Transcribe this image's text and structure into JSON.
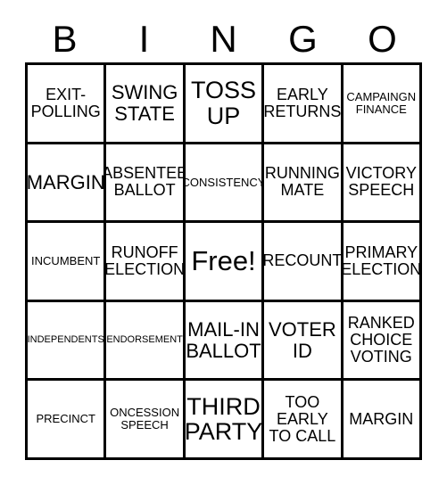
{
  "header": {
    "letters": [
      "B",
      "I",
      "N",
      "G",
      "O"
    ]
  },
  "grid": {
    "rows": 5,
    "columns": 5,
    "border_color": "#000000",
    "background_color": "#ffffff",
    "text_color": "#000000",
    "cells": [
      {
        "text": "EXIT-\nPOLLING",
        "size": "sz-md",
        "free": false
      },
      {
        "text": "SWING\nSTATE",
        "size": "sz-lg",
        "free": false
      },
      {
        "text": "TOSS\nUP",
        "size": "sz-xl",
        "free": false
      },
      {
        "text": "EARLY\nRETURNS",
        "size": "sz-md",
        "free": false
      },
      {
        "text": "CAMPAINGN\nFINANCE",
        "size": "sz-sm",
        "free": false
      },
      {
        "text": "MARGIN",
        "size": "sz-lg",
        "free": false
      },
      {
        "text": "ABSENTEE\nBALLOT",
        "size": "sz-md",
        "free": false
      },
      {
        "text": "CONSISTENCY",
        "size": "sz-sm",
        "free": false
      },
      {
        "text": "RUNNING\nMATE",
        "size": "sz-md",
        "free": false
      },
      {
        "text": "VICTORY\nSPEECH",
        "size": "sz-md",
        "free": false
      },
      {
        "text": "INCUMBENT",
        "size": "sz-sm",
        "free": false
      },
      {
        "text": "RUNOFF\nELECTION",
        "size": "sz-md",
        "free": false
      },
      {
        "text": "Free!",
        "size": "sz-free",
        "free": true
      },
      {
        "text": "RECOUNT",
        "size": "sz-md",
        "free": false
      },
      {
        "text": "PRIMARY\nELECTION",
        "size": "sz-md",
        "free": false
      },
      {
        "text": "INDEPENDENTS",
        "size": "sz-xs",
        "free": false
      },
      {
        "text": "ENDORSEMENT",
        "size": "sz-xs",
        "free": false
      },
      {
        "text": "MAIL-IN\nBALLOT",
        "size": "sz-lg",
        "free": false
      },
      {
        "text": "VOTER\nID",
        "size": "sz-lg",
        "free": false
      },
      {
        "text": "RANKED\nCHOICE\nVOTING",
        "size": "sz-md",
        "free": false
      },
      {
        "text": "PRECINCT",
        "size": "sz-sm",
        "free": false
      },
      {
        "text": "ONCESSION\nSPEECH",
        "size": "sz-sm",
        "free": false
      },
      {
        "text": "THIRD\nPARTY",
        "size": "sz-xl",
        "free": false
      },
      {
        "text": "TOO\nEARLY\nTO CALL",
        "size": "sz-md",
        "free": false
      },
      {
        "text": "MARGIN",
        "size": "sz-md",
        "free": false
      }
    ]
  }
}
